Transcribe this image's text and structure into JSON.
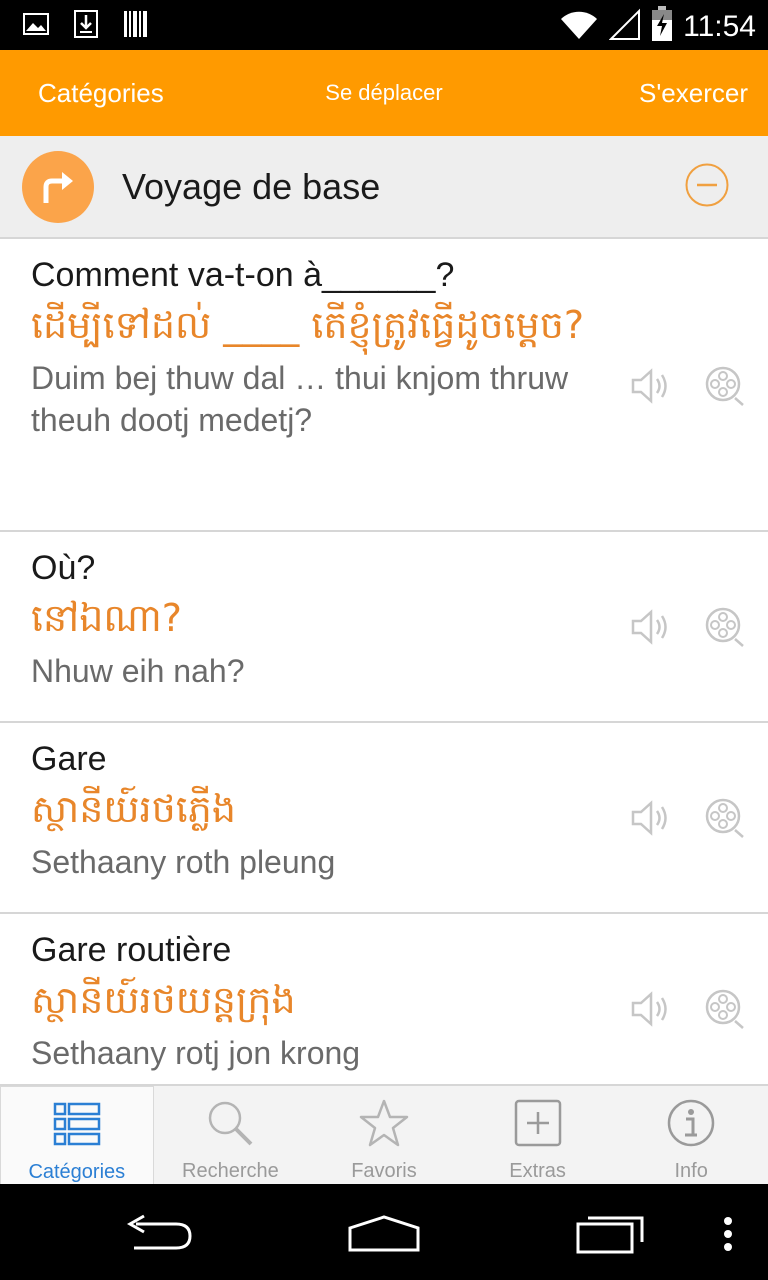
{
  "status_bar": {
    "time": "11:54",
    "left_icons": [
      "image-icon",
      "download-icon",
      "barcode-icon"
    ],
    "right_icons": [
      "wifi-icon",
      "signal-icon",
      "battery-charging-icon"
    ]
  },
  "top_bar": {
    "left_label": "Catégories",
    "center_label": "Se déplacer",
    "right_label": "S'exercer",
    "background": "#ff9a00"
  },
  "section": {
    "title": "Voyage de base",
    "icon": "redo-arrow-icon",
    "collapse_icon": "minus-circle-icon",
    "accent": "#fba44a"
  },
  "phrases": [
    {
      "french": "Comment va-t-on à______?",
      "khmer": "ដើម្បីទៅដល់ ____ តើខ្ញុំត្រូវធ្វើដូចម្តេច?",
      "phonetic": "Duim bej thuw dal … thui knjom thruw theuh dootj medetj?"
    },
    {
      "french": "Où?",
      "khmer": "នៅឯណា?",
      "phonetic": "Nhuw eih nah?"
    },
    {
      "french": "Gare",
      "khmer": "ស្ថានីយ៍រថភ្លើង",
      "phonetic": "Sethaany roth pleung"
    },
    {
      "french": "Gare routière",
      "khmer": "ស្ថានីយ៍រថយន្តក្រុង",
      "phonetic": "Sethaany rotj jon krong"
    }
  ],
  "bottom_nav": [
    {
      "label": "Catégories",
      "icon": "list-icon",
      "active": true
    },
    {
      "label": "Recherche",
      "icon": "search-icon",
      "active": false
    },
    {
      "label": "Favoris",
      "icon": "star-icon",
      "active": false
    },
    {
      "label": "Extras",
      "icon": "plus-box-icon",
      "active": false
    },
    {
      "label": "Info",
      "icon": "info-icon",
      "active": false
    }
  ],
  "colors": {
    "khmer_text": "#e8862a",
    "active_tab": "#2b7fd4"
  }
}
